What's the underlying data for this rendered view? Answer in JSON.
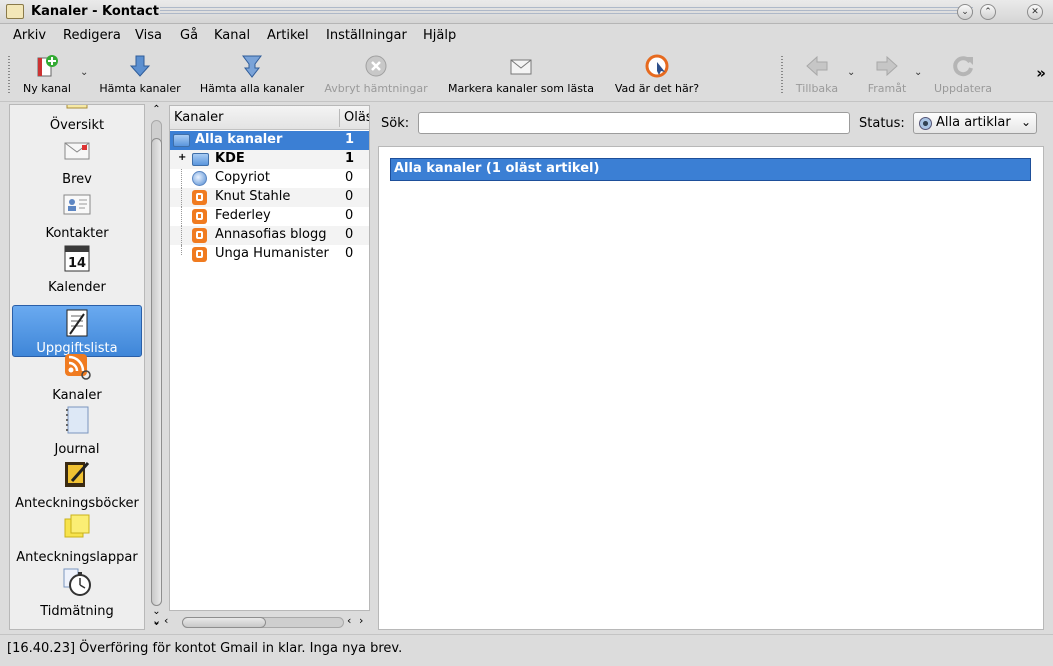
{
  "window": {
    "title": "Kanaler - Kontact"
  },
  "menu": [
    "Arkiv",
    "Redigera",
    "Visa",
    "Gå",
    "Kanal",
    "Artikel",
    "Inställningar",
    "Hjälp"
  ],
  "toolbar": {
    "new_channel": "Ny kanal",
    "fetch_channels": "Hämta kanaler",
    "fetch_all": "Hämta alla kanaler",
    "abort": "Avbryt hämtningar",
    "mark_read": "Markera kanaler som lästa",
    "whats_this": "Vad är det här?",
    "back": "Tillbaka",
    "forward": "Framåt",
    "refresh": "Uppdatera"
  },
  "sidebar": {
    "items": [
      {
        "label": "Översikt",
        "icon": "overview-icon"
      },
      {
        "label": "Brev",
        "icon": "mail-icon"
      },
      {
        "label": "Kontakter",
        "icon": "contacts-icon"
      },
      {
        "label": "Kalender",
        "icon": "calendar-icon",
        "icon_text": "14"
      },
      {
        "label": "Uppgiftslista",
        "icon": "todo-icon"
      },
      {
        "label": "Kanaler",
        "icon": "feeds-icon"
      },
      {
        "label": "Journal",
        "icon": "journal-icon"
      },
      {
        "label": "Anteckningsböcker",
        "icon": "notebook-icon"
      },
      {
        "label": "Anteckningslappar",
        "icon": "sticky-notes-icon"
      },
      {
        "label": "Tidmätning",
        "icon": "stopwatch-icon"
      }
    ],
    "active": "Uppgiftslista"
  },
  "tree": {
    "columns": [
      "Kanaler",
      "Oläs"
    ],
    "rows": [
      {
        "name": "Alla kanaler",
        "count": "1",
        "icon": "folder-icon"
      },
      {
        "name": "KDE",
        "count": "1",
        "icon": "folder-icon"
      },
      {
        "name": "Copyriot",
        "count": "0",
        "icon": "globe-icon"
      },
      {
        "name": "Knut Stahle",
        "count": "0",
        "icon": "blogger-icon"
      },
      {
        "name": "Federley",
        "count": "0",
        "icon": "blogger-icon"
      },
      {
        "name": "Annasofias blogg",
        "count": "0",
        "icon": "blogger-icon"
      },
      {
        "name": "Unga Humanister",
        "count": "0",
        "icon": "blogger-icon"
      }
    ]
  },
  "search": {
    "label": "Sök:",
    "value": ""
  },
  "status_filter": {
    "label": "Status:",
    "value": "Alla artiklar"
  },
  "article": {
    "header": "Alla kanaler (1 oläst artikel)"
  },
  "statusbar": {
    "text": "[16.40.23] Överföring för kontot Gmail in klar. Inga nya brev."
  },
  "colors": {
    "selection": "#3b7fd4",
    "active_sidebar": "#4a90e2",
    "feed_orange": "#f07b20"
  }
}
